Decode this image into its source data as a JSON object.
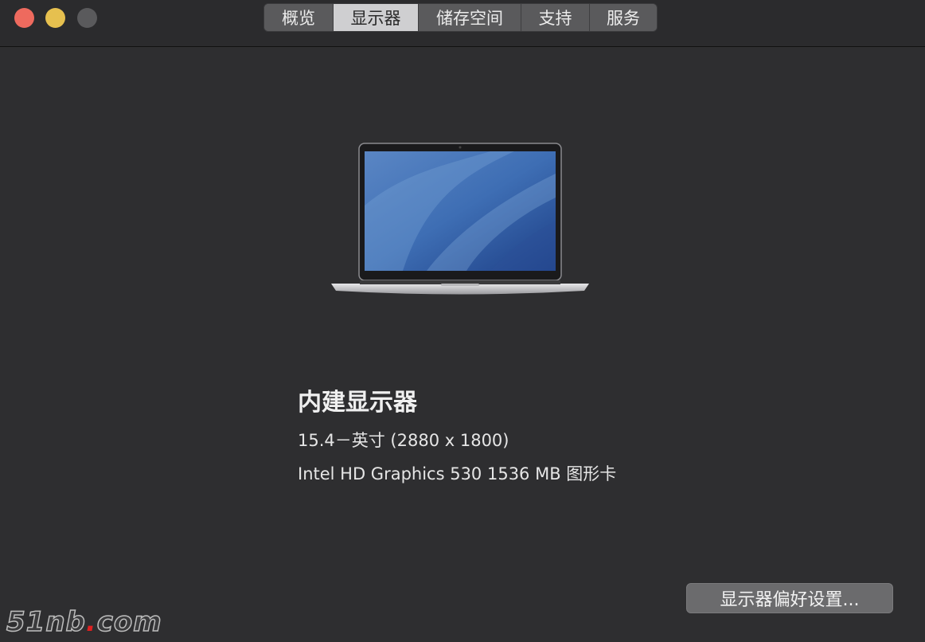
{
  "window": {
    "traffic_lights": {
      "close": "#ee6a5e",
      "minimize": "#e6c04f",
      "zoom": "#5a5a5c"
    }
  },
  "tabs": [
    {
      "label": "概览",
      "active": false
    },
    {
      "label": "显示器",
      "active": true
    },
    {
      "label": "储存空间",
      "active": false
    },
    {
      "label": "支持",
      "active": false
    },
    {
      "label": "服务",
      "active": false
    }
  ],
  "display": {
    "image_icon": "macbook-pro-icon",
    "name": "内建显示器",
    "size": "15.4－英寸 (2880 x 1800)",
    "graphics": "Intel HD Graphics 530 1536 MB 图形卡"
  },
  "buttons": {
    "preferences": "显示器偏好设置..."
  },
  "watermark": {
    "text_main": "51nb",
    "text_dot": ".",
    "text_tail": "com"
  }
}
